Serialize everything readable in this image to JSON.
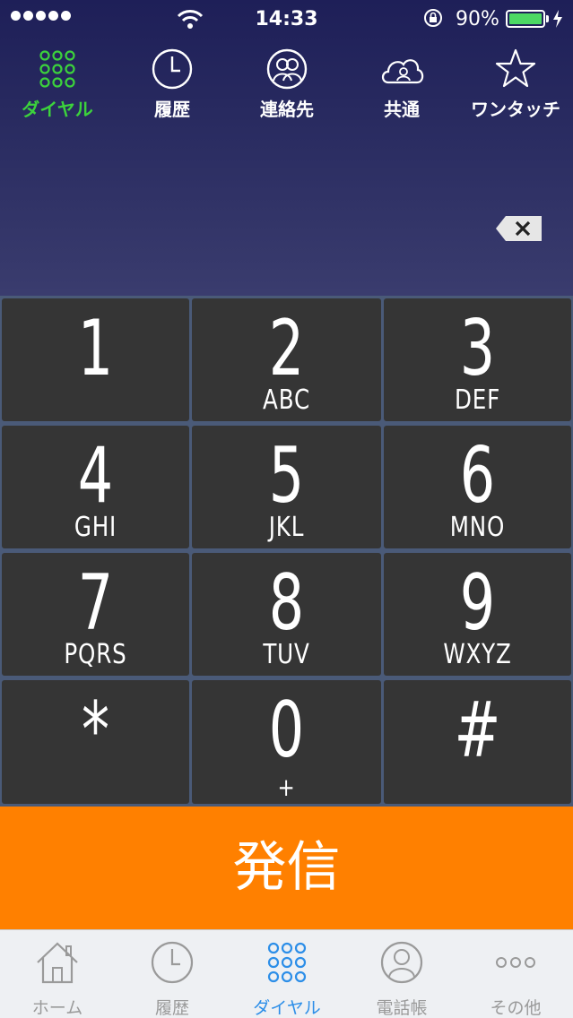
{
  "status_bar": {
    "time": "14:33",
    "battery_percent": "90%",
    "battery_level": 0.9,
    "signal_dots": 5,
    "icons": [
      "signal-dots-icon",
      "wifi-icon",
      "rotation-lock-icon",
      "battery-icon",
      "charging-bolt-icon"
    ]
  },
  "top_tabs": [
    {
      "label": "ダイヤル",
      "icon": "dialpad-icon",
      "active": true
    },
    {
      "label": "履歴",
      "icon": "clock-icon",
      "active": false
    },
    {
      "label": "連絡先",
      "icon": "contacts-icon",
      "active": false
    },
    {
      "label": "共通",
      "icon": "cloud-contacts-icon",
      "active": false
    },
    {
      "label": "ワンタッチ",
      "icon": "star-icon",
      "active": false
    }
  ],
  "number_display": "",
  "keypad": [
    {
      "digit": "1",
      "letters": ""
    },
    {
      "digit": "2",
      "letters": "ABC"
    },
    {
      "digit": "3",
      "letters": "DEF"
    },
    {
      "digit": "4",
      "letters": "GHI"
    },
    {
      "digit": "5",
      "letters": "JKL"
    },
    {
      "digit": "6",
      "letters": "MNO"
    },
    {
      "digit": "7",
      "letters": "PQRS"
    },
    {
      "digit": "8",
      "letters": "TUV"
    },
    {
      "digit": "9",
      "letters": "WXYZ"
    },
    {
      "digit": "*",
      "letters": ""
    },
    {
      "digit": "0",
      "letters": "+"
    },
    {
      "digit": "#",
      "letters": ""
    }
  ],
  "call_button": {
    "label": "発信"
  },
  "bottom_tabs": [
    {
      "label": "ホーム",
      "icon": "home-icon",
      "active": false
    },
    {
      "label": "履歴",
      "icon": "clock-icon",
      "active": false
    },
    {
      "label": "ダイヤル",
      "icon": "dialpad-icon",
      "active": true
    },
    {
      "label": "電話帳",
      "icon": "contact-icon",
      "active": false
    },
    {
      "label": "その他",
      "icon": "more-icon",
      "active": false
    }
  ],
  "colors": {
    "header_top": "#1e1f58",
    "active_green": "#3cd23c",
    "call_orange": "#ff8000",
    "active_blue": "#2c8ee8",
    "key_bg": "#353535",
    "battery_green": "#4cd964"
  }
}
